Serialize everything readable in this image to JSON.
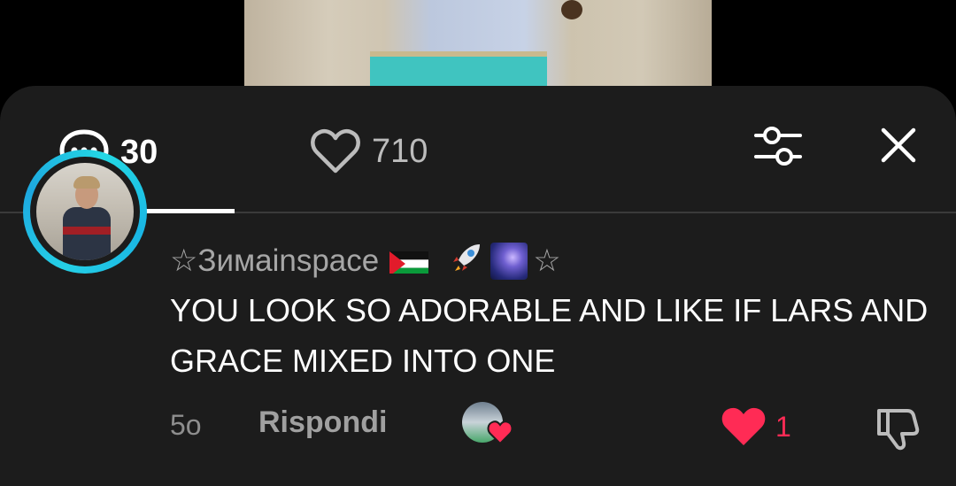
{
  "header": {
    "comments_count": "30",
    "likes_count": "710",
    "active_tab": "comments"
  },
  "comment": {
    "username": "☆Зимаinspace",
    "username_suffix_star": "☆",
    "username_emojis": [
      "palestine-flag",
      "rocket-emoji",
      "milky-way-emoji"
    ],
    "text": "YOU LOOK SO ADORABLE AND LIKE IF LARS AND GRACE MIXED INTO ONE",
    "time": "5o",
    "reply_label": "Rispondi",
    "like_count": "1",
    "liked": true,
    "liked_by_creator": true
  },
  "colors": {
    "sheet_bg": "#1c1c1c",
    "accent_like": "#ff2b55",
    "avatar_ring": "#25d0e6",
    "muted_text": "#a6a6a6"
  }
}
